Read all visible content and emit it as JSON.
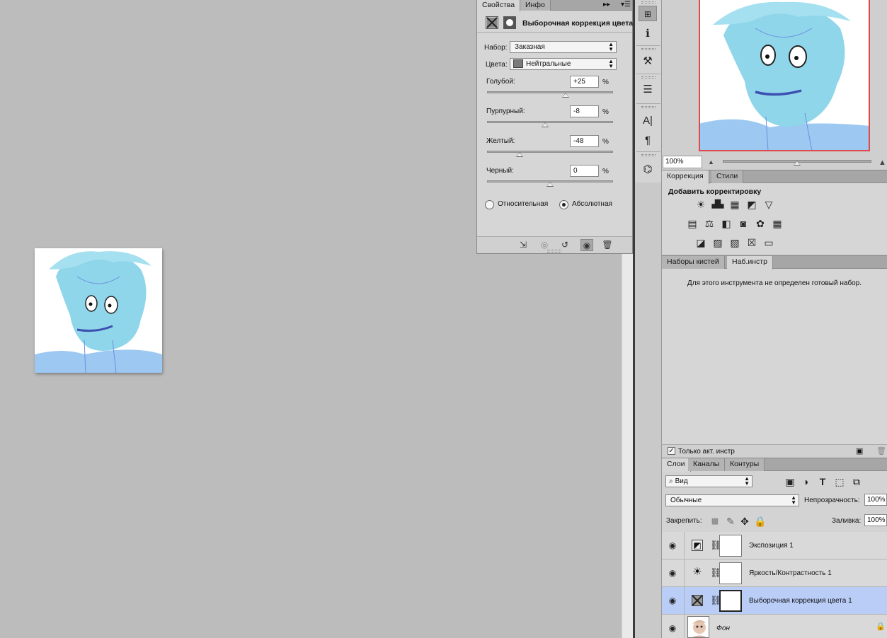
{
  "properties": {
    "tabs": [
      "Свойства",
      "Инфо"
    ],
    "title": "Выборочная коррекция цвета",
    "preset_label": "Набор:",
    "preset_value": "Заказная",
    "colors_label": "Цвета:",
    "colors_value": "Нейтральные",
    "sliders": [
      {
        "label": "Голубой:",
        "value": "+25",
        "unit": "%",
        "amount": 25
      },
      {
        "label": "Пурпурный:",
        "value": "-8",
        "unit": "%",
        "amount": -8
      },
      {
        "label": "Желтый:",
        "value": "-48",
        "unit": "%",
        "amount": -48
      },
      {
        "label": "Черный:",
        "value": "0",
        "unit": "%",
        "amount": 0
      }
    ],
    "method_relative": "Относительная",
    "method_absolute": "Абсолютная",
    "selected_method": "absolute"
  },
  "navigator": {
    "zoom": "100%"
  },
  "adjustments": {
    "tabs": [
      "Коррекция",
      "Стили"
    ],
    "title": "Добавить корректировку",
    "icon_rows": [
      [
        "brightness-contrast-icon",
        "levels-icon",
        "curves-icon",
        "exposure-icon",
        "vibrance-icon"
      ],
      [
        "hue-saturation-icon",
        "color-balance-icon",
        "black-white-icon",
        "photo-filter-icon",
        "channel-mixer-icon",
        "color-lookup-icon"
      ],
      [
        "invert-icon",
        "posterize-icon",
        "threshold-icon",
        "selective-color-icon",
        "gradient-map-icon"
      ]
    ]
  },
  "presets_panel": {
    "tabs": [
      "Наборы кистей",
      "Наб.инстр"
    ],
    "message": "Для этого инструмента не определен готовый набор.",
    "current_only": "Только акт. инстр"
  },
  "layers": {
    "tabs": [
      "Слои",
      "Каналы",
      "Контуры"
    ],
    "filter_kind": "Вид",
    "blend_mode": "Обычные",
    "opacity_label": "Непрозрачность:",
    "opacity_value": "100%",
    "lock_label": "Закрепить:",
    "fill_label": "Заливка:",
    "fill_value": "100%",
    "rows": [
      {
        "name": "Экспозиция 1",
        "icon": "exposure-icon",
        "active": false
      },
      {
        "name": "Яркость/Контрастность 1",
        "icon": "brightness-contrast-icon",
        "active": false
      },
      {
        "name": "Выборочная коррекция цвета 1",
        "icon": "selective-color-icon",
        "active": true
      },
      {
        "name": "Фон",
        "icon": "background-thumbnail",
        "active": false
      }
    ]
  },
  "colors": {
    "canvas_bg": "#bcbcbc",
    "panel_bg": "#d6d6d6",
    "selected_layer": "#b9cdf7",
    "navigator_frame": "#e14a4a",
    "art_blue": "#8fd2ec"
  }
}
